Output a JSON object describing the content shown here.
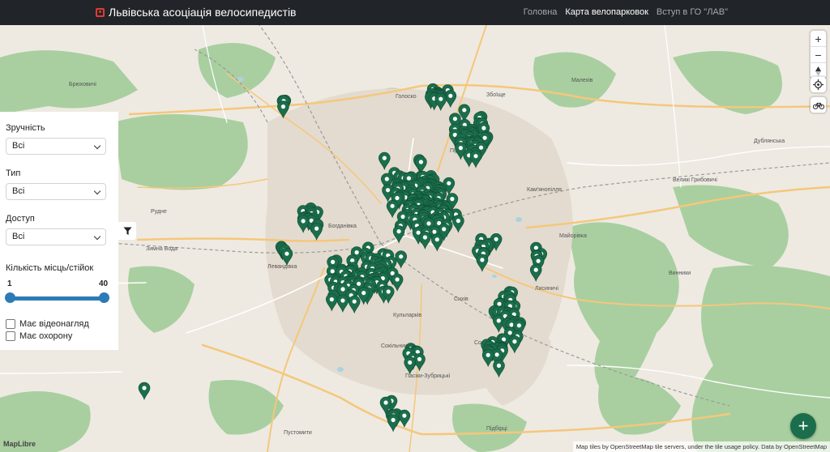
{
  "navbar": {
    "brand": "Львівська асоціація велосипедистів",
    "links": [
      "Головна",
      "Карта велопарковок",
      "Вступ в ГО \"ЛАВ\""
    ],
    "active_index": 1
  },
  "filters": {
    "convenience": {
      "label": "Зручність",
      "value": "Всі"
    },
    "type": {
      "label": "Тип",
      "value": "Всі"
    },
    "access": {
      "label": "Доступ",
      "value": "Всі"
    },
    "capacity": {
      "label": "Кількість місць/стійок",
      "min": "1",
      "max": "40"
    },
    "video": {
      "label": "Має відеонагляд",
      "checked": false
    },
    "guard": {
      "label": "Має охорону",
      "checked": false
    }
  },
  "map_controls": {
    "zoom_in": "+",
    "zoom_out": "−",
    "compass": "compass-icon",
    "geolocate": "geolocate-icon",
    "bike_layer": "bicycle-icon"
  },
  "add_button": "+",
  "attribution": "Map tiles by OpenStreetMap tile servers, under the tile usage policy. Data by OpenStreetMap",
  "maplibre_logo": "MapLibre",
  "place_labels": [
    "Голоско",
    "Збоїще",
    "Підзамче",
    "Богданівка",
    "Сихів",
    "Рудне",
    "Винники",
    "Кам'янопілля",
    "Пасіки-Зубрицькі",
    "Пустомити",
    "Зимна Вода",
    "Сокільники",
    "Солонка",
    "Лисиничі",
    "Брюховичі",
    "Малехів",
    "Дублянська",
    "Кульпарків",
    "Левандівка",
    "Майорівка",
    "Підбірці",
    "Великі Грибовичі"
  ],
  "colors": {
    "marker": "#1b6e4b",
    "navbar": "#212529",
    "forest": "#a9cfa0",
    "urban": "#e8e1d5",
    "water": "#aad3df",
    "road": "#f5c77b"
  },
  "parking_count": 380
}
